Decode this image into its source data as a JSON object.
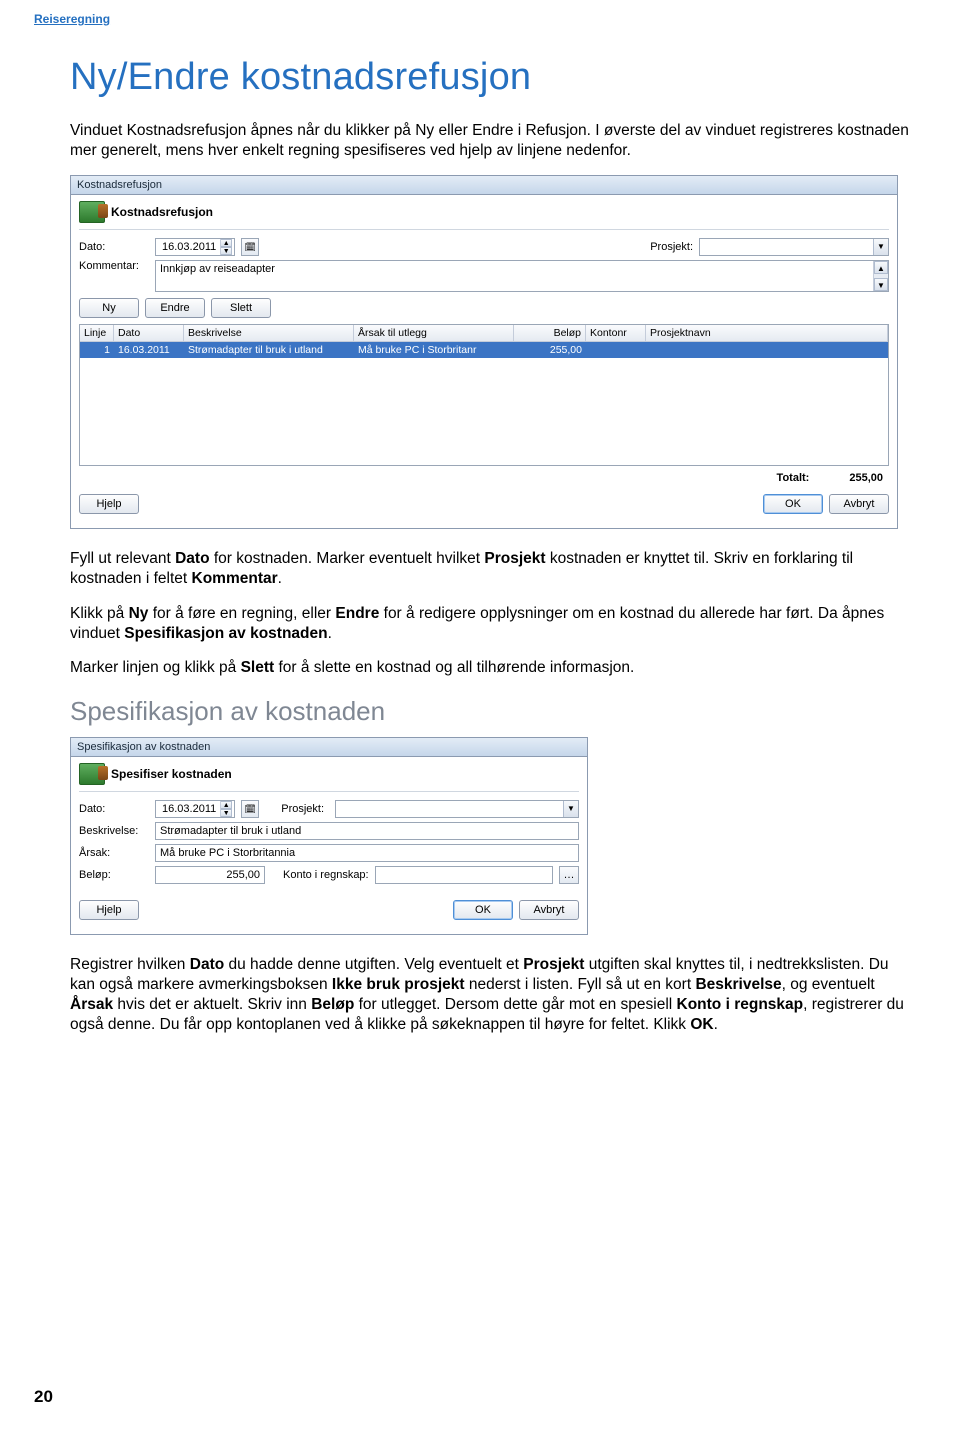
{
  "header": "Reiseregning",
  "title": "Ny/Endre kostnadsrefusjon",
  "intro_html": "Vinduet Kostnadsrefusjon åpnes når du klikker på Ny eller Endre i Refusjon. I øverste del av vinduet registreres kostnaden mer generelt, mens hver enkelt regning spesifiseres ved hjelp av linjene nedenfor.",
  "para2_parts": [
    "Fyll ut relevant ",
    "Dato",
    " for kostnaden. Marker eventuelt hvilket ",
    "Prosjekt",
    " kostnaden er knyttet til. Skriv en forklaring til kostnaden i feltet ",
    "Kommentar",
    "."
  ],
  "para3_parts": [
    "Klikk på ",
    "Ny",
    " for å føre en regning, eller ",
    "Endre",
    " for å redigere opplysninger om en kostnad du allerede har ført. Da åpnes vinduet ",
    "Spesifikasjon av kostnaden",
    "."
  ],
  "para4_parts": [
    "Marker linjen og klikk på ",
    "Slett",
    " for å slette en kostnad og all tilhørende informasjon."
  ],
  "spec_title": "Spesifikasjon av kostnaden",
  "para5_parts": [
    "Registrer hvilken ",
    "Dato",
    " du hadde denne utgiften. Velg eventuelt et ",
    "Prosjekt",
    " utgiften skal knyttes til, i nedtrekkslisten. Du kan også markere avmerkingsboksen ",
    "Ikke bruk prosjekt",
    " nederst i listen. Fyll så ut en kort ",
    "Beskrivelse",
    ", og eventuelt ",
    "Årsak",
    " hvis det er aktuelt. Skriv inn ",
    "Beløp",
    " for utlegget. Dersom dette går mot en spesiell ",
    "Konto i regnskap",
    ", registrerer du også denne. Du får opp kontoplanen ved å klikke på søkeknappen til høyre for feltet. Klikk ",
    "OK",
    "."
  ],
  "page_number": "20",
  "dialog1": {
    "title": "Kostnadsrefusjon",
    "heading": "Kostnadsrefusjon",
    "labels": {
      "dato": "Dato:",
      "prosjekt": "Prosjekt:",
      "kommentar": "Kommentar:"
    },
    "date_value": "16.03.2011",
    "kommentar_value": "Innkjøp av reiseadapter",
    "buttons": {
      "ny": "Ny",
      "endre": "Endre",
      "slett": "Slett",
      "hjelp": "Hjelp",
      "ok": "OK",
      "avbryt": "Avbryt"
    },
    "grid_headers": {
      "linje": "Linje",
      "dato": "Dato",
      "beskrivelse": "Beskrivelse",
      "arsak": "Årsak til utlegg",
      "belop": "Beløp",
      "kontonr": "Kontonr",
      "prosjektnavn": "Prosjektnavn"
    },
    "grid_row": {
      "linje": "1",
      "dato": "16.03.2011",
      "beskrivelse": "Strømadapter til bruk i utland",
      "arsak": "Må bruke PC i Storbritanr",
      "belop": "255,00",
      "kontonr": "",
      "prosjektnavn": ""
    },
    "totalt_label": "Totalt:",
    "totalt_value": "255,00"
  },
  "dialog2": {
    "title": "Spesifikasjon av kostnaden",
    "heading": "Spesifiser kostnaden",
    "labels": {
      "dato": "Dato:",
      "prosjekt": "Prosjekt:",
      "beskrivelse": "Beskrivelse:",
      "arsak": "Årsak:",
      "belop": "Beløp:",
      "konto": "Konto i regnskap:"
    },
    "date_value": "16.03.2011",
    "beskrivelse_value": "Strømadapter til bruk i utland",
    "arsak_value": "Må bruke PC i Storbritannia",
    "belop_value": "255,00",
    "buttons": {
      "hjelp": "Hjelp",
      "ok": "OK",
      "avbryt": "Avbryt"
    }
  }
}
